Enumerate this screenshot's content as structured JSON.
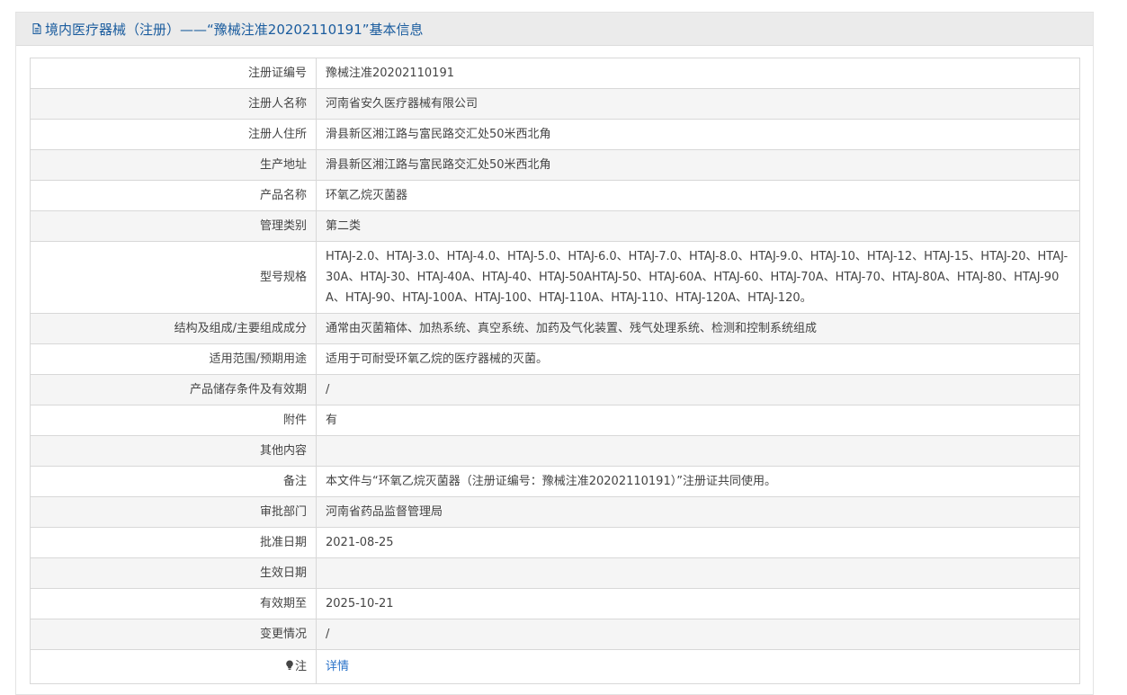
{
  "header": {
    "title": "境内医疗器械（注册）——“豫械注准20202110191”基本信息"
  },
  "rows": [
    {
      "label": "注册证编号",
      "value": "豫械注准20202110191"
    },
    {
      "label": "注册人名称",
      "value": "河南省安久医疗器械有限公司"
    },
    {
      "label": "注册人住所",
      "value": "滑县新区湘江路与富民路交汇处50米西北角"
    },
    {
      "label": "生产地址",
      "value": "滑县新区湘江路与富民路交汇处50米西北角"
    },
    {
      "label": "产品名称",
      "value": "环氧乙烷灭菌器"
    },
    {
      "label": "管理类别",
      "value": "第二类"
    },
    {
      "label": "型号规格",
      "value": "HTAJ-2.0、HTAJ-3.0、HTAJ-4.0、HTAJ-5.0、HTAJ-6.0、HTAJ-7.0、HTAJ-8.0、HTAJ-9.0、HTAJ-10、HTAJ-12、HTAJ-15、HTAJ-20、HTAJ-30A、HTAJ-30、HTAJ-40A、HTAJ-40、HTAJ-50AHTAJ-50、HTAJ-60A、HTAJ-60、HTAJ-70A、HTAJ-70、HTAJ-80A、HTAJ-80、HTAJ-90A、HTAJ-90、HTAJ-100A、HTAJ-100、HTAJ-110A、HTAJ-110、HTAJ-120A、HTAJ-120。"
    },
    {
      "label": "结构及组成/主要组成成分",
      "value": "通常由灭菌箱体、加热系统、真空系统、加药及气化装置、残气处理系统、检测和控制系统组成"
    },
    {
      "label": "适用范围/预期用途",
      "value": "适用于可耐受环氧乙烷的医疗器械的灭菌。"
    },
    {
      "label": "产品储存条件及有效期",
      "value": "/"
    },
    {
      "label": "附件",
      "value": "有"
    },
    {
      "label": "其他内容",
      "value": ""
    },
    {
      "label": "备注",
      "value": "本文件与“环氧乙烷灭菌器（注册证编号：豫械注准20202110191）”注册证共同使用。"
    },
    {
      "label": "审批部门",
      "value": "河南省药品监督管理局"
    },
    {
      "label": "批准日期",
      "value": "2021-08-25"
    },
    {
      "label": "生效日期",
      "value": ""
    },
    {
      "label": "有效期至",
      "value": "2025-10-21"
    },
    {
      "label": "变更情况",
      "value": "/"
    }
  ],
  "note": {
    "label": "注",
    "link_text": "详情",
    "icon": "lightbulb-icon"
  },
  "colors": {
    "title": "#1a5c9e",
    "link": "#2a73c9",
    "header_bg": "#ebebeb",
    "stripe": "#f5f5f5",
    "border": "#d8d8d8"
  }
}
